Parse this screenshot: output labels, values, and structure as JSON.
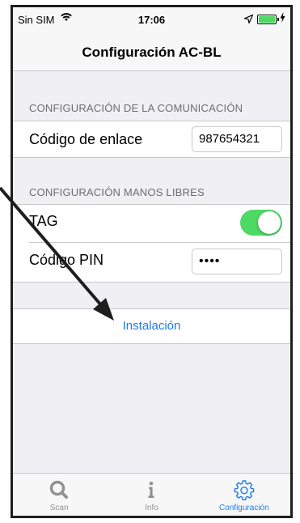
{
  "status_bar": {
    "carrier": "Sin SIM",
    "time": "17:06",
    "wifi_icon": "wifi-icon",
    "location_icon": "location-arrow-icon",
    "battery_icon": "battery-icon",
    "battery_fill_fraction": 1.0
  },
  "nav": {
    "title": "Configuración AC-BL"
  },
  "comm_section": {
    "header": "CONFIGURACIÓN DE LA COMUNICACIÓN",
    "link_code_label": "Código de enlace",
    "link_code_value": "987654321"
  },
  "handsfree_section": {
    "header": "CONFIGURACIÓN MANOS LIBRES",
    "tag_label": "TAG",
    "tag_enabled": true,
    "pin_label": "Código PIN",
    "pin_value": "••••"
  },
  "install": {
    "label": "Instalación"
  },
  "tabbar": {
    "tabs": [
      {
        "label": "Scan",
        "icon": "search-icon",
        "active": false
      },
      {
        "label": "Info",
        "icon": "info-icon",
        "active": false
      },
      {
        "label": "Configuración",
        "icon": "gear-icon",
        "active": true
      }
    ]
  },
  "colors": {
    "accent": "#1a7cf2",
    "toggle_on": "#4cd964",
    "background": "#efeff4",
    "annotation_arrow": "#1e1e1e"
  }
}
